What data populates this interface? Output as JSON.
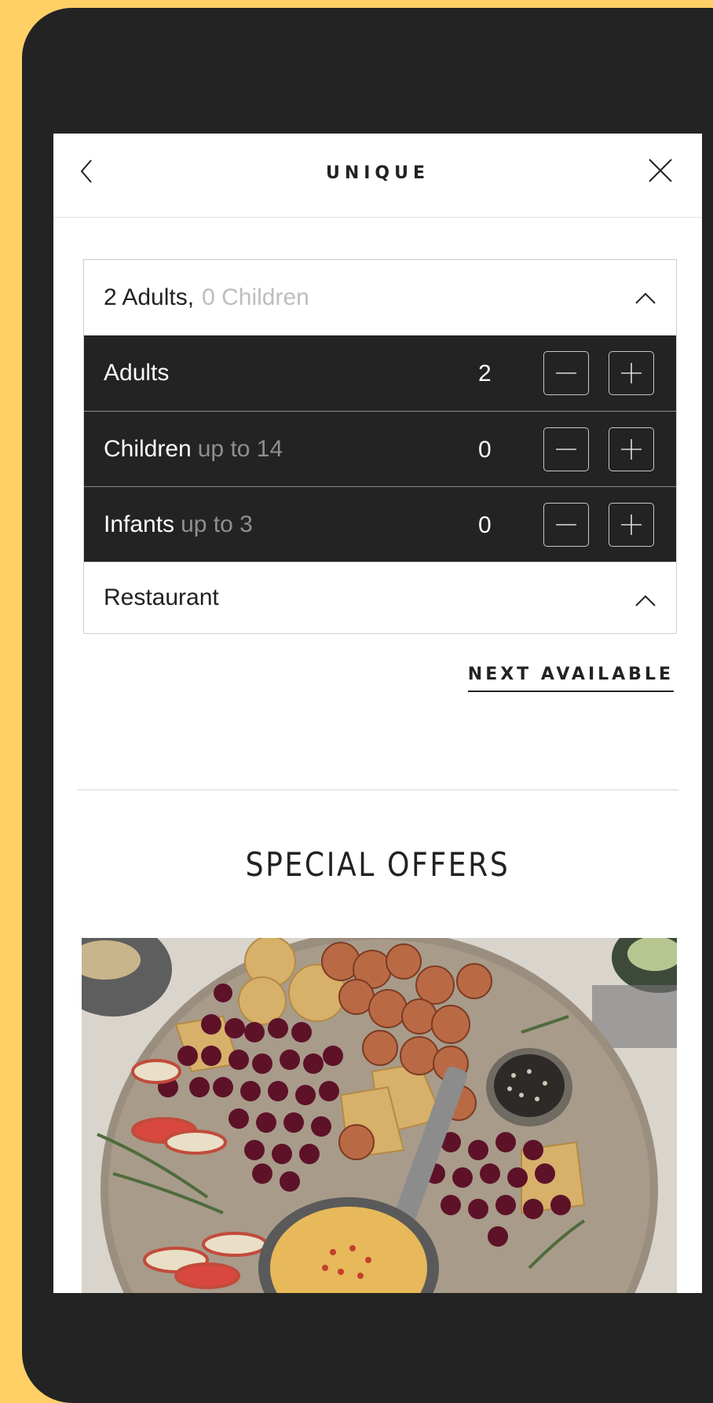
{
  "header": {
    "back_icon": "chevron-left-icon",
    "title": "UNIQUE",
    "close_icon": "close-icon"
  },
  "guests": {
    "summary_adults": "2 Adults,",
    "summary_children": "0 Children",
    "rows": [
      {
        "label": "Adults",
        "hint": "",
        "count": "2"
      },
      {
        "label": "Children",
        "hint": "up to 14",
        "count": "0"
      },
      {
        "label": "Infants",
        "hint": "up to 3",
        "count": "0"
      }
    ],
    "restaurant_label": "Restaurant"
  },
  "next_available": "NEXT AVAILABLE",
  "special_offers": {
    "title": "SPECIAL OFFERS"
  },
  "colors": {
    "frame_background": "#ffd066",
    "device": "#232323",
    "selector_rows": "#232323"
  }
}
